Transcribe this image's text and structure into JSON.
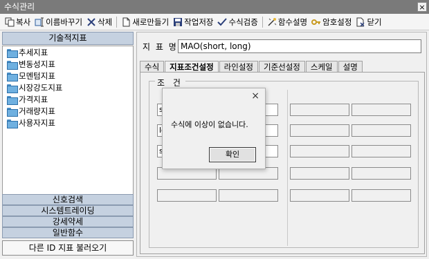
{
  "window": {
    "title": "수식관리",
    "close_glyph": "×"
  },
  "toolbar": [
    {
      "label": "복사",
      "icon": "copy-icon"
    },
    {
      "label": "이름바꾸기",
      "icon": "rename-icon"
    },
    {
      "label": "삭제",
      "icon": "delete-icon"
    },
    {
      "label": "새로만들기",
      "icon": "new-file-icon"
    },
    {
      "label": "작업저장",
      "icon": "save-icon"
    },
    {
      "label": "수식검증",
      "icon": "check-icon"
    },
    {
      "label": "함수설명",
      "icon": "function-help-icon"
    },
    {
      "label": "암호설정",
      "icon": "key-icon"
    },
    {
      "label": "닫기",
      "icon": "close-doc-icon"
    }
  ],
  "sidebar": {
    "header": "기술적지표",
    "items": [
      "추세지표",
      "변동성지표",
      "모멘텀지표",
      "시장강도지표",
      "가격지표",
      "거래량지표",
      "사용자지표"
    ],
    "categories": [
      "신호검색",
      "시스템트레이딩",
      "강세약세",
      "일반함수"
    ],
    "load_button": "다른 ID 지표 불러오기"
  },
  "main": {
    "name_label": "지 표 명",
    "name_value": "MAO(short, long)",
    "tabs": [
      "수식",
      "지표조건설정",
      "라인설정",
      "기준선설정",
      "스케일",
      "설명"
    ],
    "active_tab": "지표조건설정",
    "group_title": "조 건",
    "left_fields": [
      "sh",
      "",
      "lon",
      "",
      "si",
      ""
    ],
    "right_fields": [
      "",
      "",
      "",
      "",
      "",
      "",
      "",
      "",
      "",
      ""
    ]
  },
  "dialog": {
    "close_glyph": "×",
    "message": "수식에 이상이 없습니다.",
    "ok_label": "확인"
  }
}
